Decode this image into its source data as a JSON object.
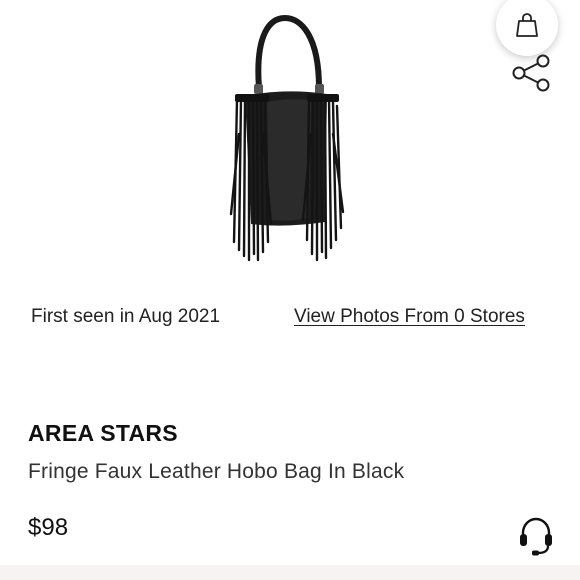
{
  "product": {
    "brand": "AREA STARS",
    "name": "Fringe Faux Leather Hobo Bag In Black",
    "price": "$98",
    "image_alt": "black fringe faux leather hobo bag"
  },
  "meta": {
    "first_seen": "First seen in Aug 2021",
    "view_photos_link": "View Photos From 0 Stores"
  },
  "icons": {
    "bag": "shopping-bag-icon",
    "share": "share-icon",
    "support": "headset-icon"
  },
  "colors": {
    "text": "#111111",
    "secondary_text": "#333333",
    "bag_leather": "#1c1c1c",
    "bottom_band": "#f7f3f3"
  }
}
